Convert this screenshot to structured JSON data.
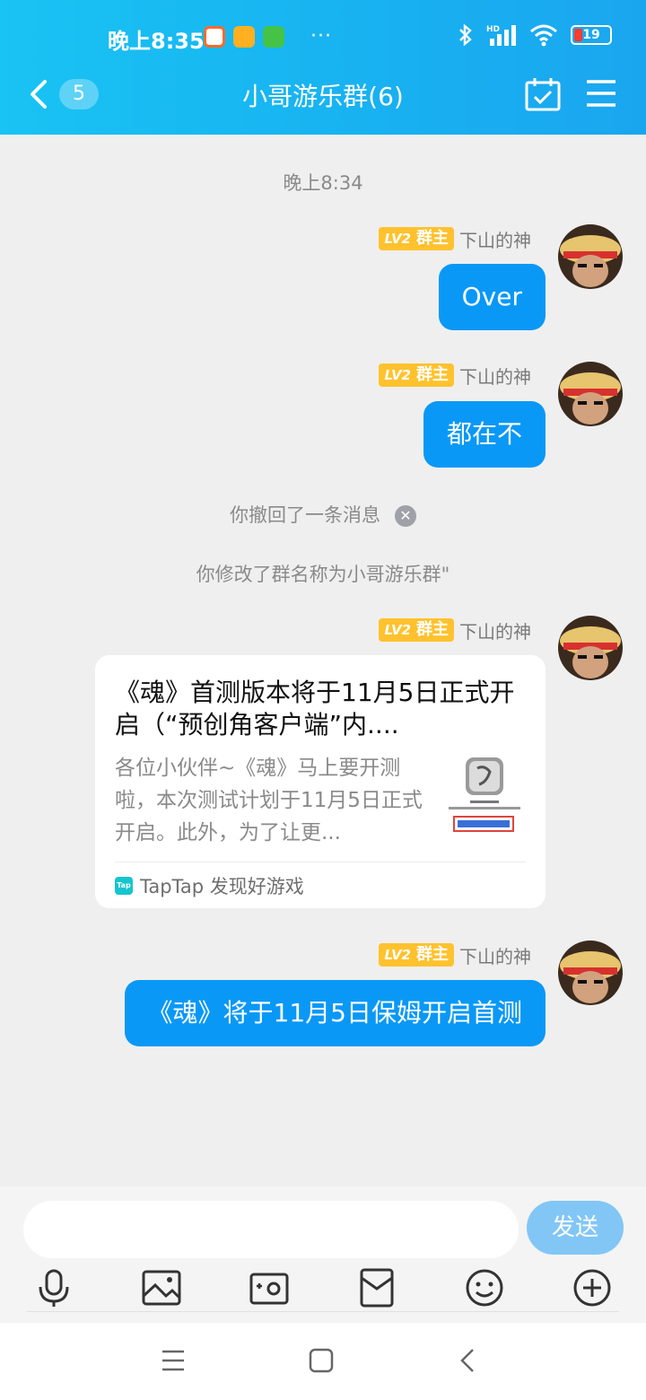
{
  "status_bar": {
    "time": "晚上8:35",
    "dots": "···",
    "battery": "19"
  },
  "header": {
    "unread_count": "5",
    "title": "小哥游乐群(6)"
  },
  "chat": {
    "timestamp": "晚上8:34",
    "messages": [
      {
        "badge_level": "LV2",
        "badge_role": "群主",
        "sender": "下山的神",
        "text": "Over"
      },
      {
        "badge_level": "LV2",
        "badge_role": "群主",
        "sender": "下山的神",
        "text": "都在不"
      },
      {
        "badge_level": "LV2",
        "badge_role": "群主",
        "sender": "下山的神"
      },
      {
        "badge_level": "LV2",
        "badge_role": "群主",
        "sender": "下山的神",
        "text": "《魂》将于11月5日保姆开启首测"
      }
    ],
    "system_recall": "你撤回了一条消息",
    "system_rename": "你修改了群名称为小哥游乐群\"",
    "card": {
      "title": "《魂》首测版本将于11月5日正式开启（“预创角客户端”内....",
      "description": "各位小伙伴~《魂》马上要开测啦，本次测试计划于11月5日正式开启。此外，为了让更...",
      "source_logo": "Tap",
      "source": "TapTap 发现好游戏"
    }
  },
  "input": {
    "placeholder": "",
    "send_label": "发送"
  },
  "colors": {
    "header": "#18b2f1",
    "bubble": "#0a98f6",
    "badge": "#ffc22e",
    "send": "#82c6f6"
  },
  "icons": [
    "back-icon",
    "calendar-check-icon",
    "menu-icon",
    "microphone-icon",
    "image-icon",
    "camera-icon",
    "red-packet-icon",
    "emoji-icon",
    "plus-icon"
  ]
}
